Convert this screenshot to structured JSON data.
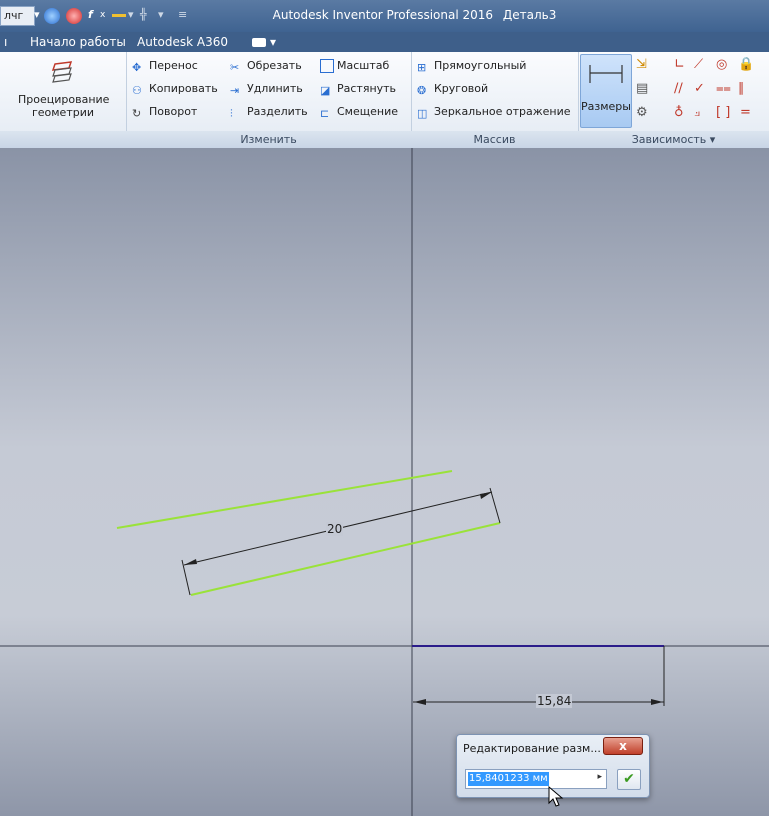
{
  "titlebar": {
    "qa_dropdown": "лчг",
    "title": "Autodesk Inventor Professional 2016",
    "document": "Деталь3",
    "fx": "f"
  },
  "tabs": [
    "Начало работы",
    "Autodesk A360"
  ],
  "ribbon": {
    "projection": {
      "label_1": "Проецирование",
      "label_2": "геометрии"
    },
    "modify": {
      "label": "Изменить",
      "items": [
        "Перенос",
        "Обрезать",
        "Масштаб",
        "Копировать",
        "Удлинить",
        "Растянуть",
        "Поворот",
        "Разделить",
        "Смещение"
      ]
    },
    "pattern": {
      "label": "Массив",
      "items": [
        "Прямоугольный",
        "Круговой",
        "Зеркальное отражение"
      ]
    },
    "constraints": {
      "dimension_label": "Размеры",
      "label": "Зависимость"
    }
  },
  "canvas": {
    "dim_20": "20",
    "dim_1584": "15,84"
  },
  "dialog": {
    "title": "Редактирование разм...",
    "close": "x",
    "value": "15,8401233 мм",
    "ok": "✔"
  },
  "colors": {
    "sketch_line": "#9ae23a",
    "highlight": "#2b1c8a",
    "selection": "#3399ff"
  }
}
